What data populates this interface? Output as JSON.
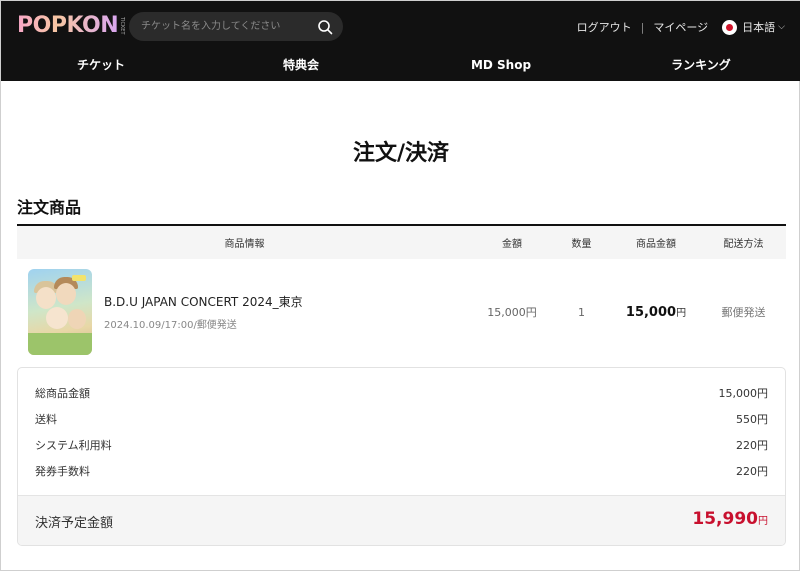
{
  "header": {
    "logo_text": "POPKON",
    "logo_sub": "TICKET",
    "search_placeholder": "チケット名を入力してください",
    "logout": "ログアウト",
    "separator": "|",
    "mypage": "マイページ",
    "language": "日本語"
  },
  "nav": [
    "チケット",
    "特典会",
    "MD Shop",
    "ランキング"
  ],
  "page_title": "注文/決済",
  "order": {
    "section_title": "注文商品",
    "columns": {
      "info": "商品情報",
      "price": "金額",
      "qty": "数量",
      "total": "商品金額",
      "ship": "配送方法"
    },
    "item": {
      "name": "B.D.U JAPAN CONCERT 2024_東京",
      "meta": "2024.10.09/17:00/郵便発送",
      "price": "15,000円",
      "qty": "1",
      "total_value": "15,000",
      "total_unit": "円",
      "ship": "郵便発送"
    }
  },
  "summary": {
    "lines": [
      {
        "label": "総商品金額",
        "value": "15,000円"
      },
      {
        "label": "送料",
        "value": "550円"
      },
      {
        "label": "システム利用料",
        "value": "220円"
      },
      {
        "label": "発券手数料",
        "value": "220円"
      }
    ],
    "total_label": "決済予定金額",
    "total_value": "15,990",
    "total_unit": "円"
  },
  "colors": {
    "header_bg": "#111111",
    "accent_red": "#c8102e"
  }
}
